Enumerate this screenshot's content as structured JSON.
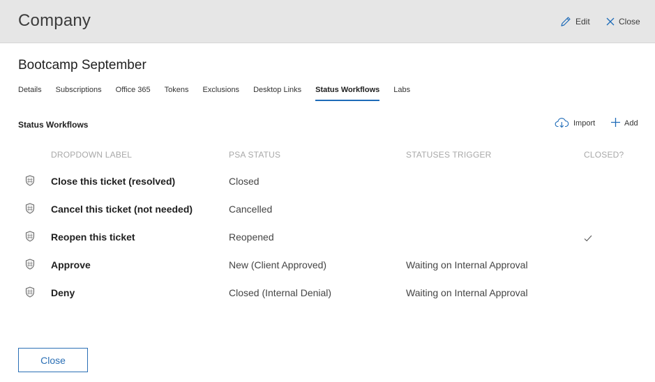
{
  "header": {
    "title": "Company",
    "edit_label": "Edit",
    "close_label": "Close"
  },
  "page": {
    "title": "Bootcamp September"
  },
  "tabs": [
    {
      "label": "Details",
      "active": false
    },
    {
      "label": "Subscriptions",
      "active": false
    },
    {
      "label": "Office 365",
      "active": false
    },
    {
      "label": "Tokens",
      "active": false
    },
    {
      "label": "Exclusions",
      "active": false
    },
    {
      "label": "Desktop Links",
      "active": false
    },
    {
      "label": "Status Workflows",
      "active": true
    },
    {
      "label": "Labs",
      "active": false
    }
  ],
  "section": {
    "title": "Status Workflows",
    "import_label": "Import",
    "add_label": "Add"
  },
  "table": {
    "columns": [
      "DROPDOWN LABEL",
      "PSA STATUS",
      "STATUSES TRIGGER",
      "CLOSED?"
    ],
    "rows": [
      {
        "label": "Close this ticket (resolved)",
        "psa_status": "Closed",
        "trigger": "",
        "closed": false
      },
      {
        "label": "Cancel this ticket (not needed)",
        "psa_status": "Cancelled",
        "trigger": "",
        "closed": false
      },
      {
        "label": "Reopen this ticket",
        "psa_status": "Reopened",
        "trigger": "",
        "closed": true
      },
      {
        "label": "Approve",
        "psa_status": "New (Client Approved)",
        "trigger": "Waiting on Internal Approval",
        "closed": false
      },
      {
        "label": "Deny",
        "psa_status": "Closed (Internal Denial)",
        "trigger": "Waiting on Internal Approval",
        "closed": false
      }
    ]
  },
  "footer": {
    "close_button_label": "Close"
  },
  "colors": {
    "accent": "#1e6bb8",
    "header_bg": "#e6e6e6",
    "muted_text": "#a8a8a8"
  },
  "icons": {
    "row_icon": "shield-icon",
    "edit": "pencil-icon",
    "close": "close-icon",
    "import": "cloud-download-icon",
    "add": "plus-icon",
    "closed": "checkmark-icon"
  }
}
